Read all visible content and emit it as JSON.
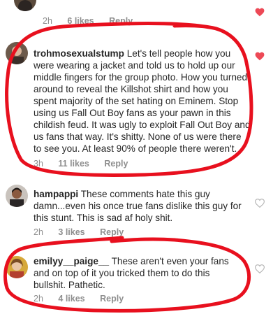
{
  "colors": {
    "liked_heart": "#ed4956",
    "outline_heart": "#b5b5b5",
    "annotation": "#e8101e",
    "meta_text": "#8e8e8e"
  },
  "top_row": {
    "time": "2h",
    "likes": "6 likes",
    "reply": "Reply",
    "liked": true
  },
  "comments": [
    {
      "username": "trohmosexualstump",
      "text": "Let's tell people how you were wearing a jacket and told us to hold up our middle fingers for the group photo. How you turned around to reveal the Killshot shirt and how you spent majority of the set hating on Eminem. Stop using us Fall Out Boy fans as your pawn in this childish feud. It was ugly to exploit Fall Out Boy and us fans that way. It's shitty. None of us were there to see you. At least 90% of people there weren't.",
      "time": "3h",
      "likes": "11 likes",
      "reply": "Reply",
      "liked": true
    },
    {
      "username": "hampappi",
      "text": "These comments hate this guy damn...even his once true fans dislike this guy for this stunt. This is sad af holy shit.",
      "time": "2h",
      "likes": "3 likes",
      "reply": "Reply",
      "liked": false
    },
    {
      "username": "emilyy__paige__",
      "text": "These aren't even your fans and on top of it you tricked them to do this bullshit. Pathetic.",
      "time": "2h",
      "likes": "4 likes",
      "reply": "Reply",
      "liked": false
    }
  ]
}
